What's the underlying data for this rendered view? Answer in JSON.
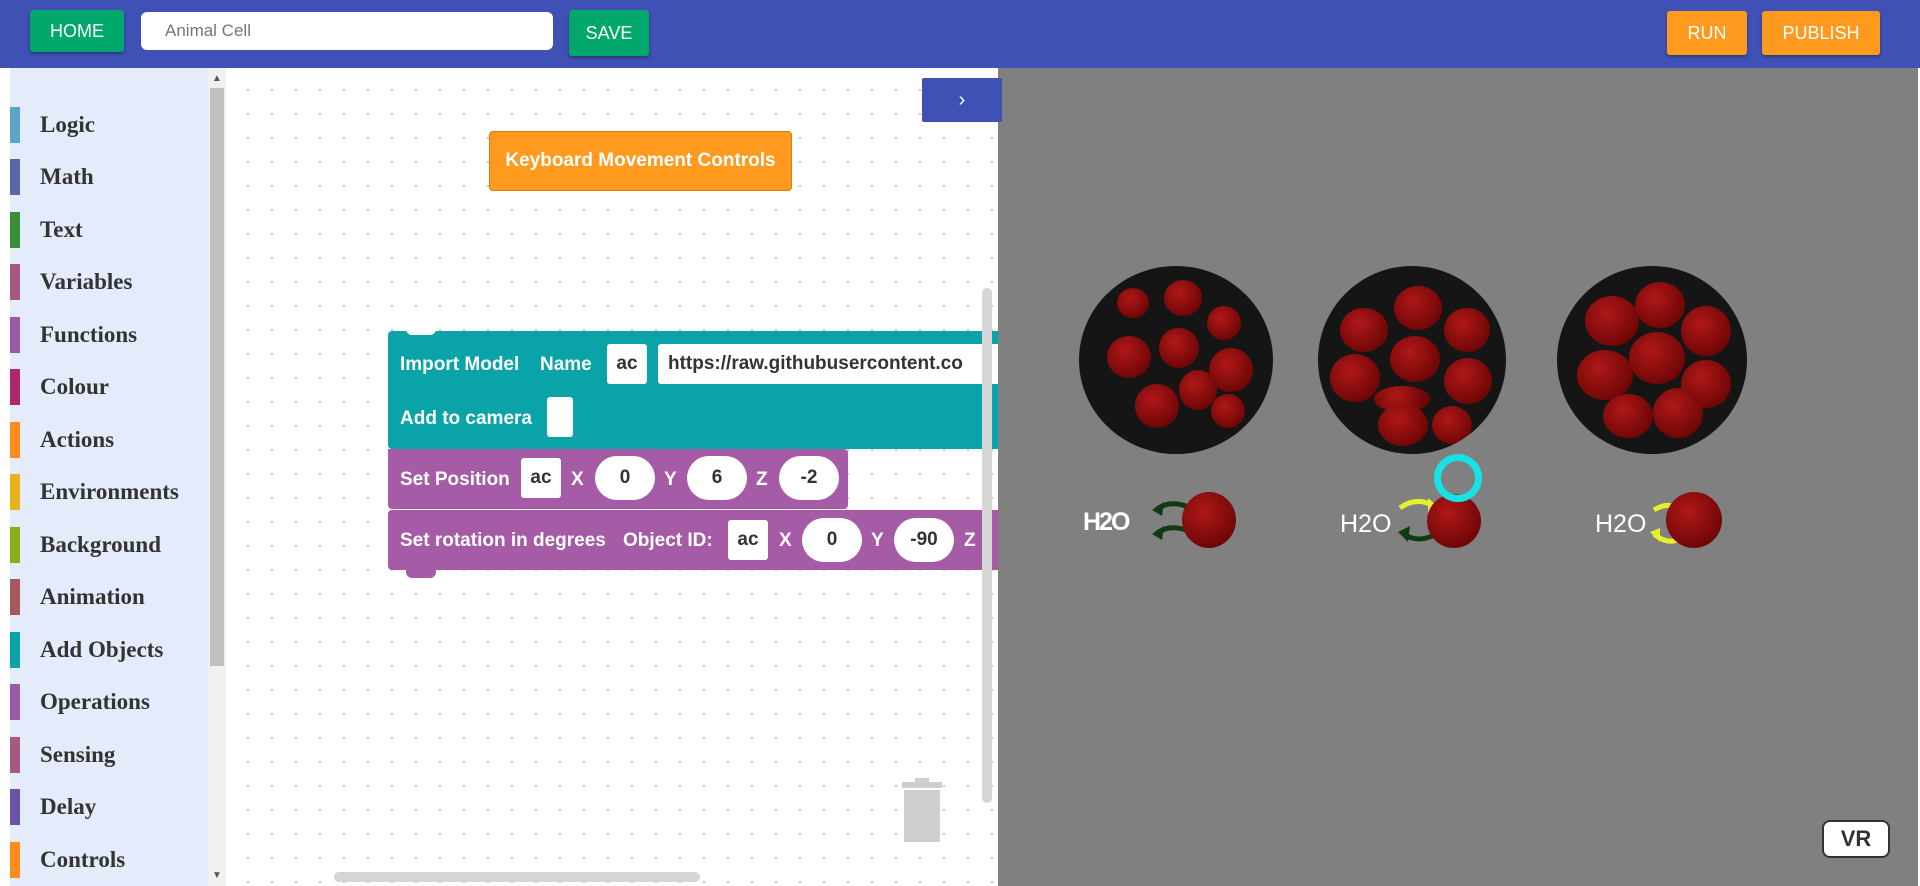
{
  "header": {
    "home_label": "HOME",
    "project_name_placeholder": "Animal Cell",
    "save_label": "SAVE",
    "run_label": "RUN",
    "publish_label": "PUBLISH"
  },
  "toolbox": {
    "categories": [
      {
        "label": "Logic",
        "color": "#5ba5c8"
      },
      {
        "label": "Math",
        "color": "#5b67a5"
      },
      {
        "label": "Text",
        "color": "#3a8e3a"
      },
      {
        "label": "Variables",
        "color": "#a55b80"
      },
      {
        "label": "Functions",
        "color": "#995ba5"
      },
      {
        "label": "Colour",
        "color": "#b0286c"
      },
      {
        "label": "Actions",
        "color": "#ff8c1a"
      },
      {
        "label": "Environments",
        "color": "#e6b31a"
      },
      {
        "label": "Background",
        "color": "#86b01a"
      },
      {
        "label": "Animation",
        "color": "#a5595b"
      },
      {
        "label": "Add Objects",
        "color": "#0aa3a8"
      },
      {
        "label": "Operations",
        "color": "#995ba5"
      },
      {
        "label": "Sensing",
        "color": "#a55b80"
      },
      {
        "label": "Delay",
        "color": "#6a55a5"
      },
      {
        "label": "Controls",
        "color": "#ff8c1a"
      }
    ]
  },
  "workspace": {
    "event_block": "Keyboard Movement Controls",
    "import_model": {
      "label": "Import Model",
      "name_label": "Name",
      "name_value": "ac",
      "url_value": "https://raw.githubusercontent.co",
      "camera_label": "Add to camera"
    },
    "set_position": {
      "label": "Set Position",
      "object": "ac",
      "x_label": "X",
      "x_value": "0",
      "y_label": "Y",
      "y_value": "6",
      "z_label": "Z",
      "z_value": "-2"
    },
    "set_rotation": {
      "label": "Set rotation in degrees",
      "object_id_label": "Object ID:",
      "object": "ac",
      "x_label": "X",
      "x_value": "0",
      "y_label": "Y",
      "y_value": "-90",
      "z_label": "Z"
    }
  },
  "preview": {
    "h2o_labels": [
      "H2O",
      "H2O",
      "H2O"
    ],
    "vr_label": "VR"
  },
  "colors": {
    "header": "#3f51b5",
    "green_button": "#00a86b",
    "orange_button": "#ff9a1f",
    "teal_block": "#0aa3a8",
    "purple_block": "#a55ba5",
    "preview_bg": "#808080"
  }
}
